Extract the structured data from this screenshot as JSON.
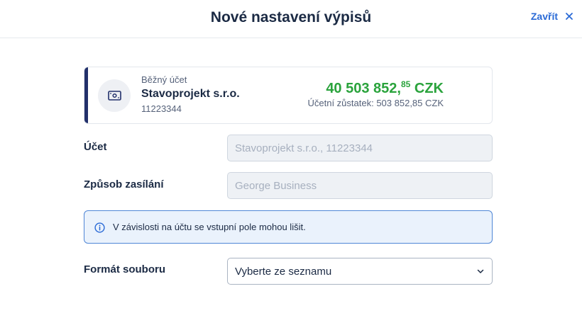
{
  "header": {
    "title": "Nové nastavení výpisů",
    "close_label": "Zavřít"
  },
  "account_card": {
    "type_label": "Běžný účet",
    "name": "Stavoprojekt s.r.o.",
    "number": "11223344",
    "balance_main": "40 503 852,",
    "balance_decimals": "85",
    "balance_currency": " CZK",
    "accounting_balance": "Účetní zůstatek: 503 852,85 CZK",
    "icon": "banknote-icon"
  },
  "form": {
    "account_label": "Účet",
    "account_placeholder": "Stavoprojekt s.r.o., 11223344",
    "delivery_label": "Způsob zasílání",
    "delivery_placeholder": "George Business",
    "info_text": "V závislosti na účtu se vstupní pole mohou lišit.",
    "format_label": "Formát souboru",
    "format_value": "Vyberte ze seznamu"
  },
  "colors": {
    "accent_blue": "#2a6ad6",
    "balance_green": "#2aa33c",
    "card_accent": "#22306b",
    "info_border": "#4f86d6"
  }
}
